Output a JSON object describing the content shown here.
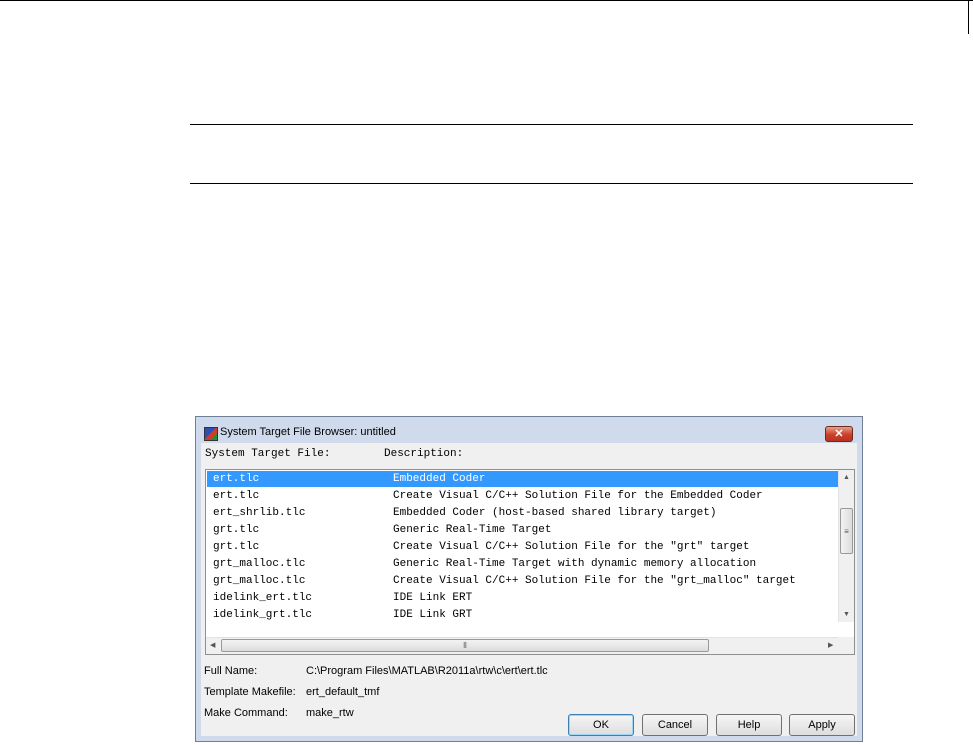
{
  "dialog": {
    "title": "System Target File Browser: untitled",
    "icon": "simulink-icon",
    "close_label": "✕"
  },
  "list": {
    "headers": [
      "System Target File:",
      "Description:"
    ],
    "rows": [
      {
        "file": "ert.tlc",
        "description": "Embedded Coder",
        "selected": true
      },
      {
        "file": "ert.tlc",
        "description": "Create Visual C/C++ Solution File for the Embedded Coder"
      },
      {
        "file": "ert_shrlib.tlc",
        "description": "Embedded Coder (host-based shared library target)"
      },
      {
        "file": "grt.tlc",
        "description": "Generic Real-Time Target"
      },
      {
        "file": "grt.tlc",
        "description": "Create Visual C/C++ Solution File for the \"grt\" target"
      },
      {
        "file": "grt_malloc.tlc",
        "description": "Generic Real-Time Target with dynamic memory allocation"
      },
      {
        "file": "grt_malloc.tlc",
        "description": "Create Visual C/C++ Solution File for the \"grt_malloc\" target"
      },
      {
        "file": "idelink_ert.tlc",
        "description": "IDE Link ERT"
      },
      {
        "file": "idelink_grt.tlc",
        "description": "IDE Link GRT"
      }
    ]
  },
  "details": {
    "full_name_label": "Full Name:",
    "full_name_value": "C:\\Program Files\\MATLAB\\R2011a\\rtw\\c\\ert\\ert.tlc",
    "template_makefile_label": "Template Makefile:",
    "template_makefile_value": "ert_default_tmf",
    "make_command_label": "Make Command:",
    "make_command_value": "make_rtw"
  },
  "buttons": {
    "ok": "OK",
    "cancel": "Cancel",
    "help": "Help",
    "apply": "Apply"
  },
  "colors": {
    "selection": "#3399ff",
    "title_bar": "#cfdbec",
    "close_button": "#c8402a"
  }
}
